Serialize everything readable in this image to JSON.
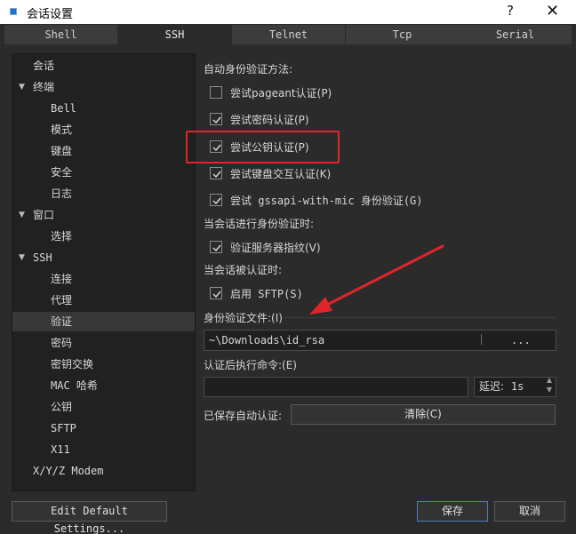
{
  "window": {
    "title": "会话设置",
    "help": "?",
    "close": "✕"
  },
  "tabs": [
    "Shell",
    "SSH",
    "Telnet",
    "Tcp",
    "Serial"
  ],
  "tree": [
    {
      "label": "会话",
      "caret": ""
    },
    {
      "label": "终端",
      "caret": "▼"
    },
    {
      "label": "Bell",
      "caret": ""
    },
    {
      "label": "模式",
      "caret": ""
    },
    {
      "label": "键盘",
      "caret": ""
    },
    {
      "label": "安全",
      "caret": ""
    },
    {
      "label": "日志",
      "caret": ""
    },
    {
      "label": "窗口",
      "caret": "▼"
    },
    {
      "label": "选择",
      "caret": ""
    },
    {
      "label": "SSH",
      "caret": "▼"
    },
    {
      "label": "连接",
      "caret": ""
    },
    {
      "label": "代理",
      "caret": ""
    },
    {
      "label": "验证",
      "caret": ""
    },
    {
      "label": "密码",
      "caret": ""
    },
    {
      "label": "密钥交换",
      "caret": ""
    },
    {
      "label": "MAC 哈希",
      "caret": ""
    },
    {
      "label": "公钥",
      "caret": ""
    },
    {
      "label": "SFTP",
      "caret": ""
    },
    {
      "label": "X11",
      "caret": ""
    },
    {
      "label": "X/Y/Z Modem",
      "caret": ""
    }
  ],
  "auth": {
    "section_title": "自动身份验证方法:",
    "methods": [
      {
        "label": "尝试pageant认证(P)",
        "checked": false
      },
      {
        "label": "尝试密码认证(P)",
        "checked": true
      },
      {
        "label": "尝试公钥认证(P)",
        "checked": true
      },
      {
        "label": "尝试键盘交互认证(K)",
        "checked": true
      },
      {
        "label": "尝试 gssapi-with-mic 身份验证(G)",
        "checked": true
      }
    ],
    "during_title": "当会话进行身份验证时:",
    "verify_label": "验证服务器指纹(V)",
    "verify_checked": true,
    "authenticated_title": "当会话被认证时:",
    "sftp_label": "启用 SFTP(S)",
    "sftp_checked": true,
    "file_label": "身份验证文件:(I)",
    "file_value": "~\\Downloads\\id_rsa",
    "browse_label": "...",
    "command_label": "认证后执行命令:(E)",
    "command_value": "",
    "delay_label": "延迟:",
    "delay_value": "1s",
    "saved_label": "已保存自动认证:",
    "clear_label": "清除(C)"
  },
  "footer": {
    "edit_default": "Edit Default Settings...",
    "save": "保存",
    "cancel": "取消"
  },
  "colors": {
    "highlight": "#e0252a",
    "arrow": "#e0252a"
  }
}
